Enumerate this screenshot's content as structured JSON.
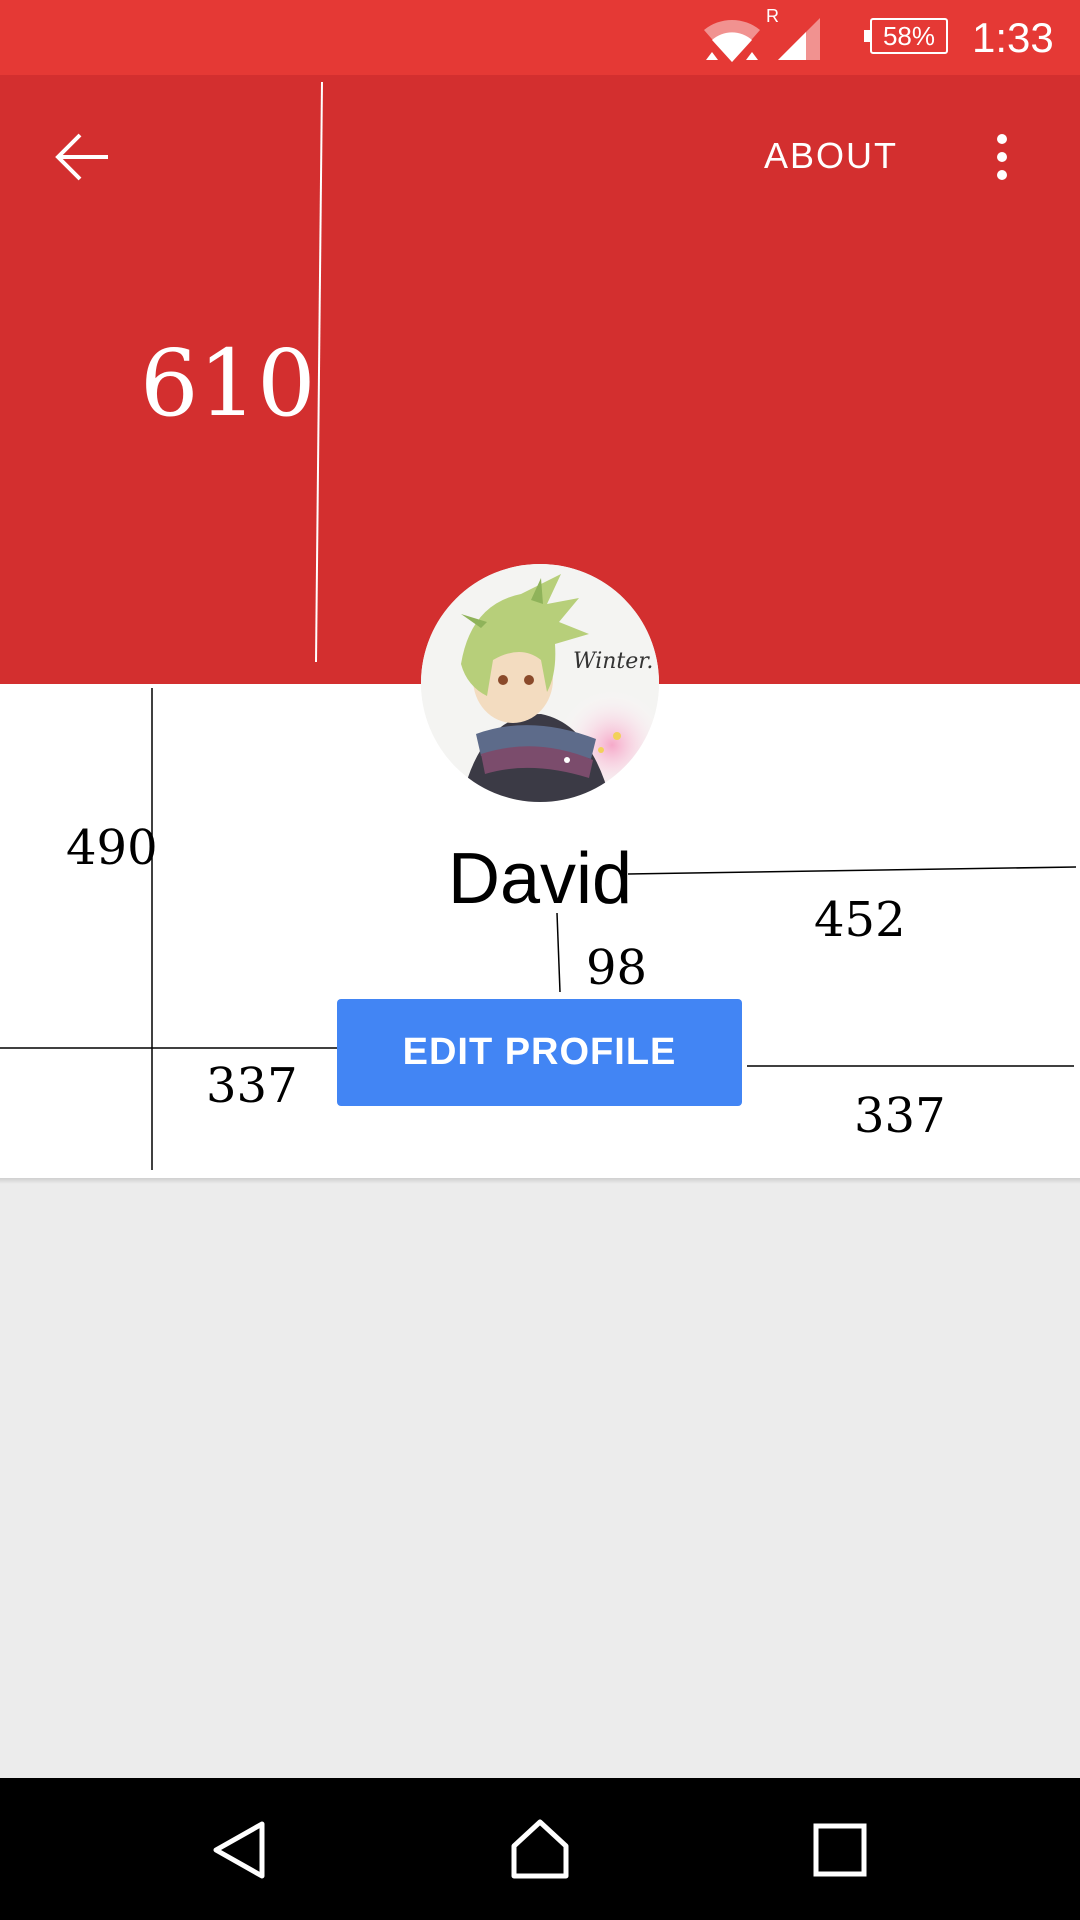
{
  "status_bar": {
    "roaming_indicator": "R",
    "battery_percent": "58%",
    "time": "1:33",
    "icons": [
      "wifi-icon",
      "signal-icon",
      "battery-icon"
    ]
  },
  "toolbar": {
    "about_label": "ABOUT",
    "icons": [
      "back-arrow-icon",
      "more-vert-icon"
    ]
  },
  "profile": {
    "name": "David",
    "edit_button_label": "EDIT PROFILE",
    "avatar_caption": "Winter."
  },
  "measurements": {
    "header_height": "610",
    "card_height": "490",
    "name_right_margin": "452",
    "name_to_button_gap": "98",
    "button_left_margin": "337",
    "button_right_margin": "337"
  },
  "navigation_bar": {
    "icons": [
      "nav-back-icon",
      "nav-home-icon",
      "nav-recents-icon"
    ]
  },
  "colors": {
    "status_bar": "#e53935",
    "header": "#d32f2f",
    "button": "#4285f4",
    "background": "#ececec"
  }
}
